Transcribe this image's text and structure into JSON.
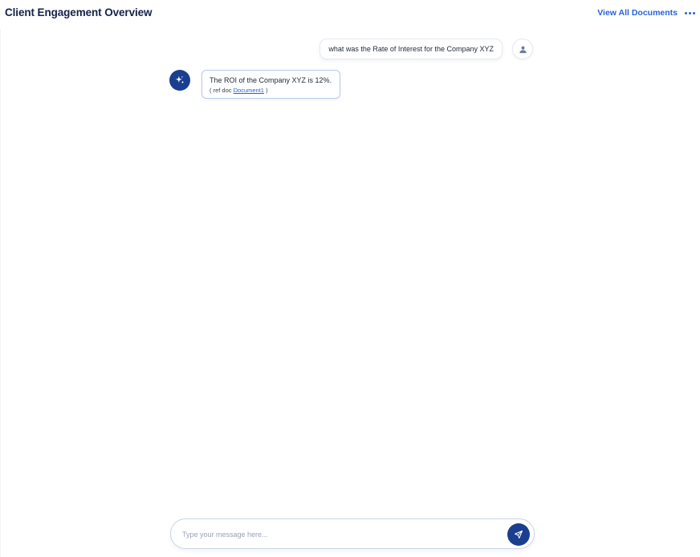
{
  "header": {
    "title": "Client Engagement Overview",
    "view_all_label": "View All Documents"
  },
  "chat": {
    "user_message": "what was the Rate of Interest for the Company XYZ",
    "bot_message": "The ROI of the Company XYZ  is 12%.",
    "bot_ref_prefix": "( ref doc",
    "bot_ref_link": "Document1",
    "bot_ref_suffix": ")"
  },
  "composer": {
    "placeholder": "Type your message here..."
  },
  "colors": {
    "accent": "#2563d9",
    "brand_dark": "#1a3f8f",
    "title": "#16224a"
  },
  "icons": {
    "more": "more-horizontal-icon",
    "user": "user-icon",
    "bot": "sparkles-icon",
    "send": "send-icon"
  }
}
